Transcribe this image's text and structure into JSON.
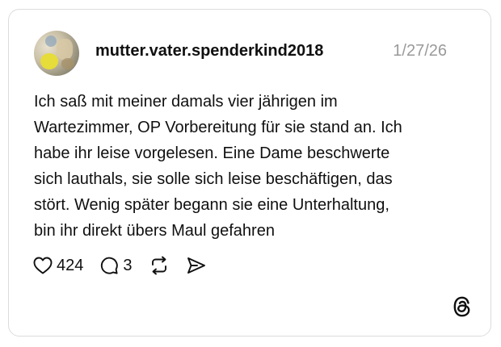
{
  "post": {
    "username": "mutter.vater.spenderkind2018",
    "date": "1/27/26",
    "body_lines": [
      "Ich saß mit meiner damals vier jährigen im",
      "Wartezimmer, OP Vorbereitung für sie stand an. Ich",
      "habe ihr leise vorgelesen. Eine Dame beschwerte",
      "sich lauthals, sie solle sich leise beschäftigen, das",
      "stört. Wenig später begann sie eine Unterhaltung,",
      "bin ihr direkt übers Maul gefahren"
    ],
    "likes": "424",
    "replies": "3"
  },
  "icons": {
    "like": "heart-icon",
    "reply": "comment-icon",
    "repost": "repost-icon",
    "share": "send-icon",
    "brand": "threads-logo-icon"
  },
  "colors": {
    "text": "#101010",
    "muted": "#9a9a9a",
    "border": "#dcdcdc"
  }
}
